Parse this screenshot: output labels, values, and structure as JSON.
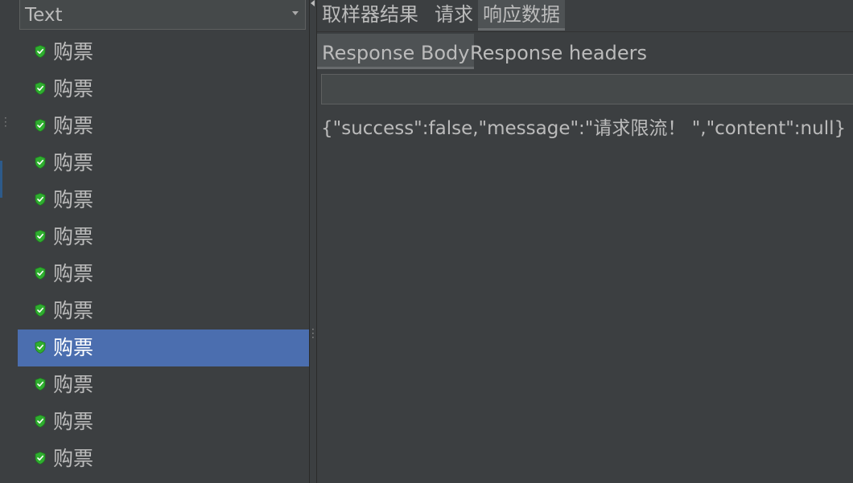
{
  "left_panel": {
    "renderer_select": {
      "value": "Text"
    },
    "results": [
      {
        "label": "购票",
        "status": "success-shield-icon",
        "selected": false
      },
      {
        "label": "购票",
        "status": "success-shield-icon",
        "selected": false
      },
      {
        "label": "购票",
        "status": "success-shield-icon",
        "selected": false
      },
      {
        "label": "购票",
        "status": "success-shield-icon",
        "selected": false
      },
      {
        "label": "购票",
        "status": "success-shield-icon",
        "selected": false
      },
      {
        "label": "购票",
        "status": "success-shield-icon",
        "selected": false
      },
      {
        "label": "购票",
        "status": "success-shield-icon",
        "selected": false
      },
      {
        "label": "购票",
        "status": "success-shield-icon",
        "selected": false
      },
      {
        "label": "购票",
        "status": "success-shield-icon",
        "selected": true
      },
      {
        "label": "购票",
        "status": "success-shield-icon",
        "selected": false
      },
      {
        "label": "购票",
        "status": "success-shield-icon",
        "selected": false
      },
      {
        "label": "购票",
        "status": "success-shield-icon",
        "selected": false
      }
    ]
  },
  "right_panel": {
    "top_tabs": [
      {
        "label": "取样器结果",
        "active": false
      },
      {
        "label": "请求",
        "active": false
      },
      {
        "label": "响应数据",
        "active": true
      }
    ],
    "sub_tabs": [
      {
        "label": "Response Body",
        "active": true
      },
      {
        "label": "Response headers",
        "active": false
      }
    ],
    "search": {
      "value": ""
    },
    "response_body": "{\"success\":false,\"message\":\"请求限流！ \",\"content\":null}"
  },
  "colors": {
    "background": "#3c3f41",
    "selection": "#4b6eaf",
    "text": "#bbbbbb",
    "success_icon": "#3fc53f"
  }
}
